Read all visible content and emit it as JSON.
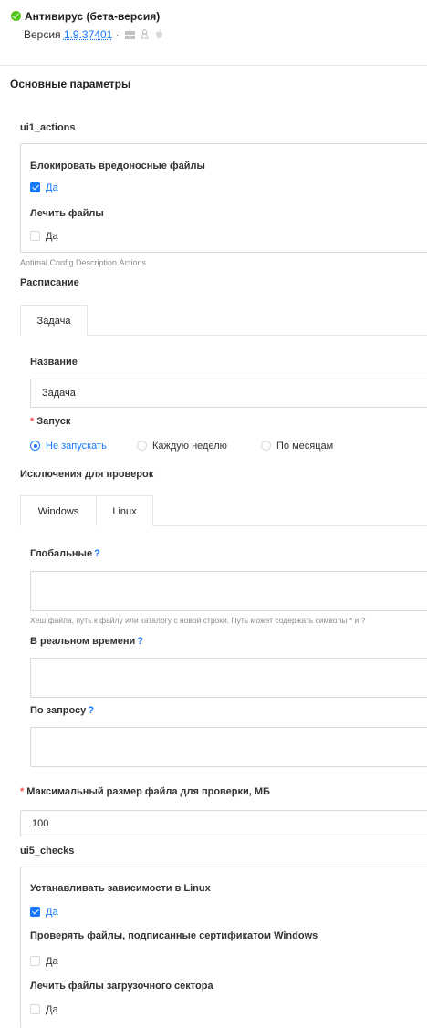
{
  "header": {
    "title": "Антивирус (бета-версия)",
    "version_prefix": "Версия",
    "version_number": "1.9.37401",
    "version_sep": "·",
    "os_icons": [
      "windows-icon",
      "linux-icon",
      "apple-icon"
    ]
  },
  "main_section": {
    "title": "Основные параметры"
  },
  "actions": {
    "title": "ui1_actions",
    "block_label": "Блокировать вредоносные файлы",
    "block_option": "Да",
    "block_checked": true,
    "cure_label": "Лечить файлы",
    "cure_option": "Да",
    "cure_checked": false,
    "hint": "Antimal.Config.Description.Actions"
  },
  "schedule": {
    "title": "Расписание",
    "tab_label": "Задача",
    "name_label": "Название",
    "name_value": "Задача",
    "launch_label": "Запуск",
    "launch_options": [
      "Не запускать",
      "Каждую неделю",
      "По месяцам"
    ],
    "launch_selected": "Не запускать"
  },
  "exclusions": {
    "title": "Исключения для проверок",
    "tabs": [
      "Windows",
      "Linux"
    ],
    "global_label": "Глобальные",
    "help_mark": "?",
    "global_value": "",
    "hint": "Хеш файла, путь к файлу или каталогу с новой строки. Путь может содержать символы * и ?",
    "realtime_label": "В реальном времени",
    "realtime_value": "",
    "ondemand_label": "По запросу",
    "ondemand_value": ""
  },
  "max_size": {
    "label": "Максимальный размер файла для проверки, МБ",
    "value": "100"
  },
  "checks": {
    "title": "ui5_checks",
    "deps_label": "Устанавливать зависимости в Linux",
    "deps_option": "Да",
    "deps_checked": true,
    "signed_label": "Проверять файлы, подписанные сертификатом Windows",
    "signed_option": "Да",
    "signed_checked": false,
    "boot_label": "Лечить файлы загрузочного сектора",
    "boot_option": "Да",
    "boot_checked": false
  },
  "colors": {
    "accent": "#1677ff",
    "success": "#52c41a",
    "required": "#ff4d4f",
    "border": "#d9d9d9"
  }
}
